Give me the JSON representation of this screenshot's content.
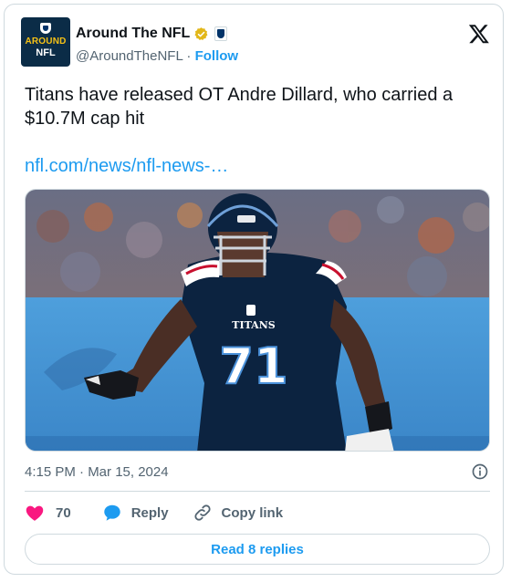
{
  "author": {
    "display_name": "Around The NFL",
    "handle": "@AroundTheNFL",
    "separator": "·",
    "follow_label": "Follow",
    "avatar_text_line1": "AROUND",
    "avatar_text_line2": "NFL",
    "verified_icon": "verified-gold-badge-icon",
    "affiliate_icon": "nfl-shield-icon"
  },
  "platform_icon": "x-logo-icon",
  "tweet": {
    "text": "Titans have released OT Andre Dillard, who carried a $10.7M cap hit",
    "link_text": "nfl.com/news/nfl-news-…",
    "media_description_icon": "photo"
  },
  "meta": {
    "timestamp": "4:15 PM · Mar 15, 2024",
    "info_icon": "info-icon"
  },
  "actions": {
    "like_count": "70",
    "reply_label": "Reply",
    "copy_link_label": "Copy link",
    "read_replies_label": "Read 8 replies"
  },
  "photo": {
    "jersey_number": "71",
    "jersey_wordmark": "TITANS"
  },
  "colors": {
    "accent": "#1d9bf0",
    "like": "#f91880",
    "text_primary": "#0f1419",
    "text_secondary": "#536471",
    "border": "#cfd9de",
    "jersey_navy": "#0c2340",
    "jersey_sky": "#4b92db"
  }
}
